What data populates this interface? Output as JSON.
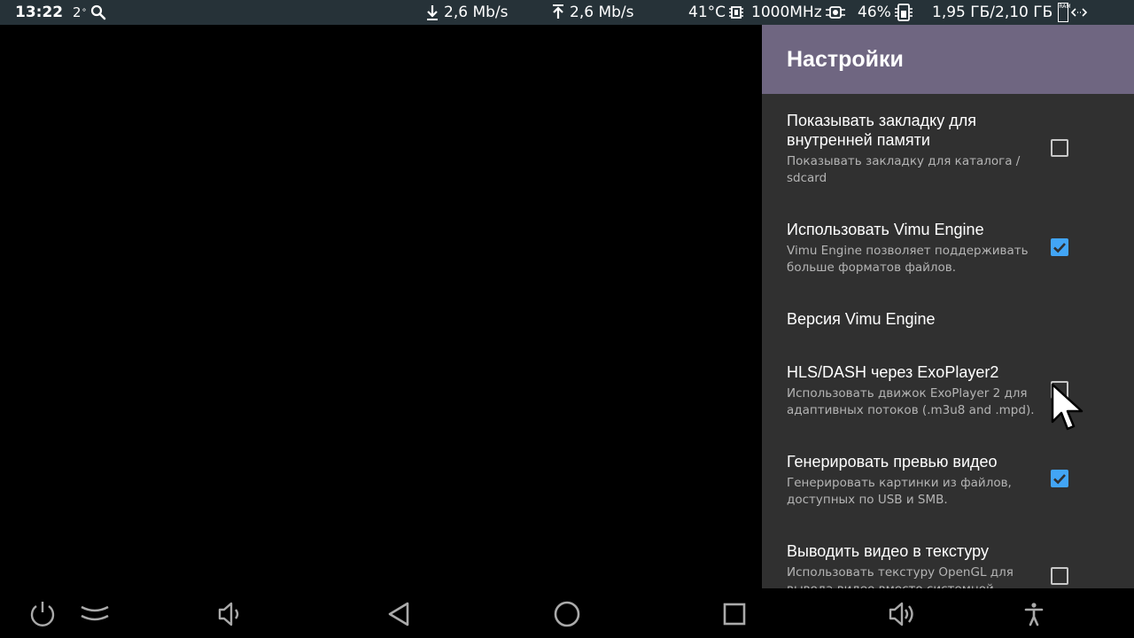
{
  "status_bar": {
    "time": "13:22",
    "notification_count": "2",
    "notification_mark": "°",
    "download_speed": "2,6 Mb/s",
    "upload_speed": "2,6 Mb/s",
    "cpu_temp": "41°C",
    "cpu_freq": "1000MHz",
    "battery": "46%",
    "ram": "1,95 ГБ/2,10 ГБ",
    "ram_label": "RAM"
  },
  "settings": {
    "title": "Настройки",
    "items": [
      {
        "title": "Показывать закладку для внутренней памяти",
        "subtitle": "Показывать закладку для каталога / sdcard",
        "checked": false
      },
      {
        "title": "Использовать Vimu Engine",
        "subtitle": "Vimu Engine позволяет поддерживать больше форматов файлов.",
        "checked": true
      },
      {
        "title": "Версия Vimu Engine",
        "subtitle": ""
      },
      {
        "title": "HLS/DASH через ExoPlayer2",
        "subtitle": "Использовать движок ExoPlayer 2 для адаптивных потоков (.m3u8 and .mpd).",
        "checked": false
      },
      {
        "title": "Генерировать превью видео",
        "subtitle": "Генерировать картинки из файлов, доступных по USB и SMB.",
        "checked": true
      },
      {
        "title": "Выводить видео в текстуру",
        "subtitle": "Использовать текстуру OpenGL для вывода видео вместо системной",
        "checked": false
      }
    ]
  },
  "colors": {
    "status_bar_bg": "#263238",
    "header_bg": "#6f6681",
    "panel_bg": "#303030",
    "checkbox_on": "#42a5f5"
  },
  "icons": {
    "status": [
      "search-icon",
      "download-icon",
      "upload-icon",
      "cpu-chip-icon",
      "cpu-speed-icon",
      "battery-icon",
      "ram-icon",
      "network-arrows-icon"
    ],
    "nav": [
      "power-icon",
      "chevron-double-down-icon",
      "volume-down-icon",
      "back-icon",
      "home-icon",
      "recents-icon",
      "volume-up-icon",
      "accessibility-icon"
    ]
  }
}
